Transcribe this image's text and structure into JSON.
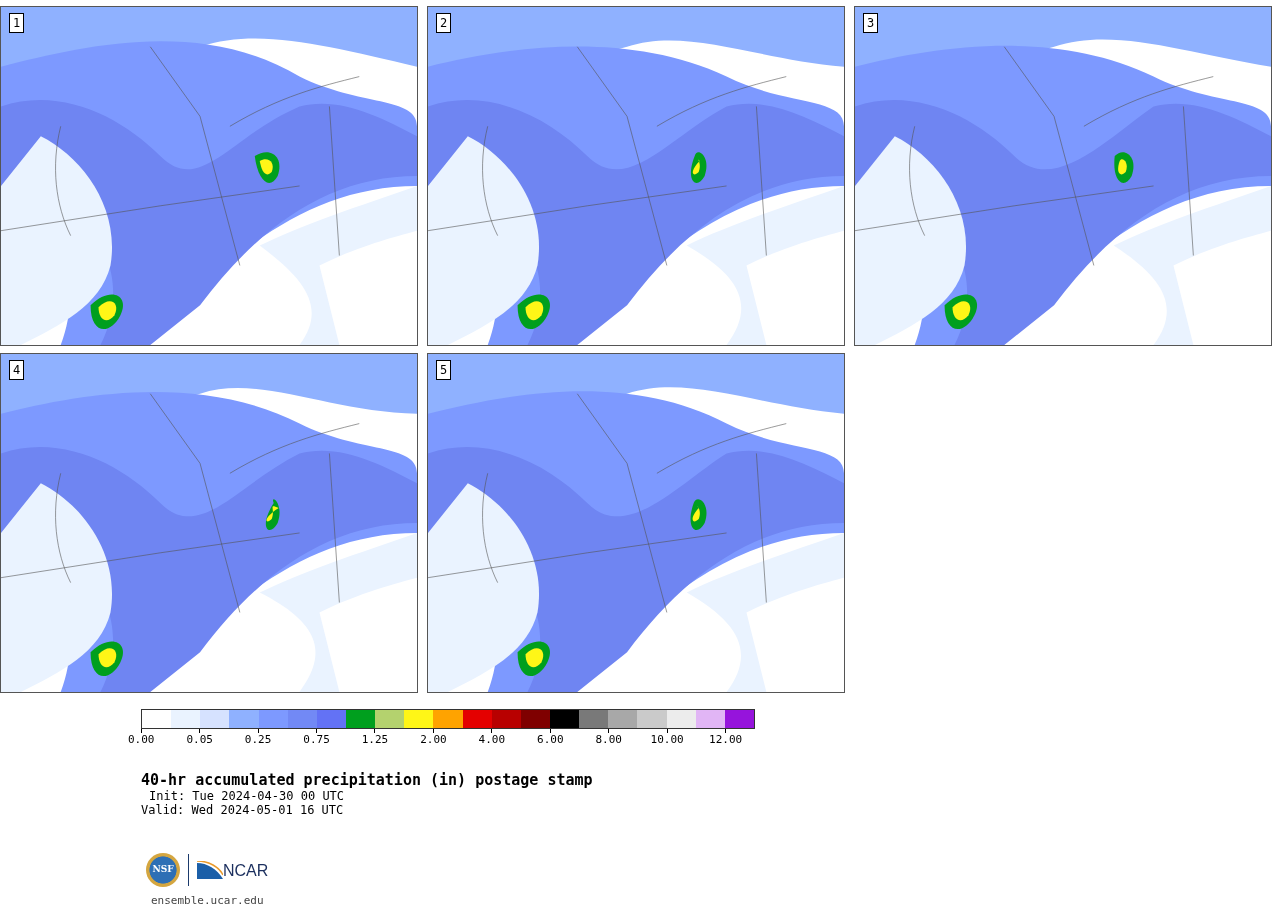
{
  "panels": [
    {
      "label": "1"
    },
    {
      "label": "2"
    },
    {
      "label": "3"
    },
    {
      "label": "4"
    },
    {
      "label": "5"
    }
  ],
  "colorbar": {
    "swatches": [
      {
        "color": "#ffffff"
      },
      {
        "color": "#eaf3ff"
      },
      {
        "color": "#d6e2ff"
      },
      {
        "color": "#8fb1ff"
      },
      {
        "color": "#7d99ff"
      },
      {
        "color": "#7289f5"
      },
      {
        "color": "#6372f5"
      },
      {
        "color": "#009f1e"
      },
      {
        "color": "#b4d26e"
      },
      {
        "color": "#fff617"
      },
      {
        "color": "#ffa300"
      },
      {
        "color": "#e40000"
      },
      {
        "color": "#b80000"
      },
      {
        "color": "#7f0000"
      },
      {
        "color": "#000000"
      },
      {
        "color": "#797979"
      },
      {
        "color": "#a8a8a8"
      },
      {
        "color": "#cacaca"
      },
      {
        "color": "#ececec"
      },
      {
        "color": "#e1b5f5"
      },
      {
        "color": "#9614dc"
      }
    ],
    "tick_labels": [
      "0.00",
      "0.05",
      "0.25",
      "0.75",
      "1.25",
      "2.00",
      "4.00",
      "6.00",
      "8.00",
      "10.00",
      "12.00"
    ]
  },
  "title": "40-hr accumulated precipitation (in) postage stamp",
  "init": "Init: Tue 2024-04-30 00 UTC",
  "valid": "Valid: Wed 2024-05-01 16 UTC",
  "logo": {
    "nsf": "NSF",
    "ncar": "NCAR"
  },
  "site": "ensemble.ucar.edu"
}
